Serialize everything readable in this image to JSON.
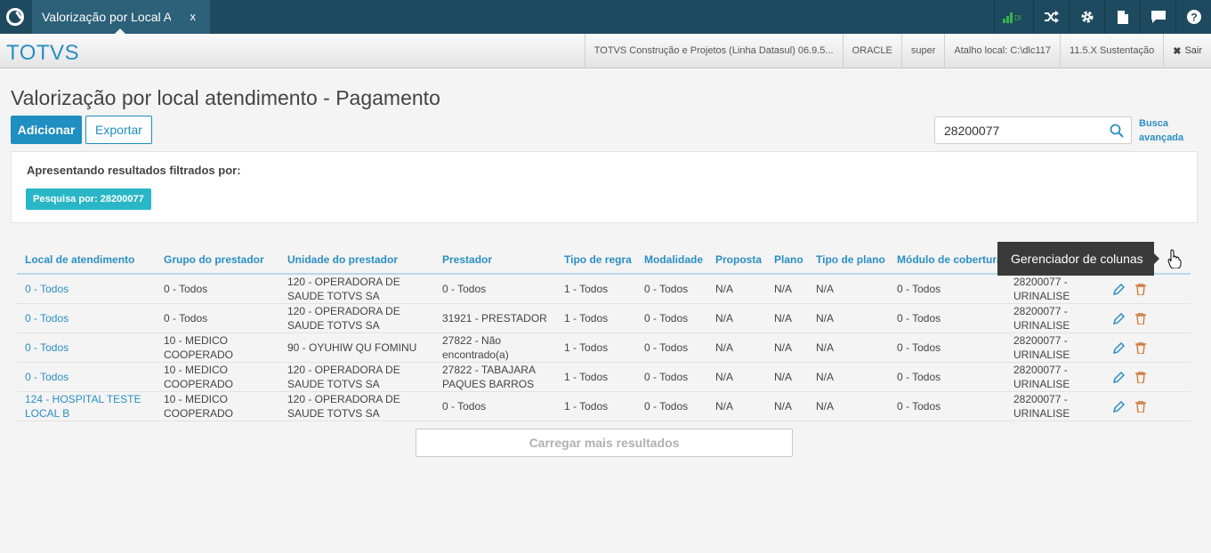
{
  "tab": {
    "title": "Valorização por Local Atendimento",
    "close": "x"
  },
  "topbar": {
    "signal_label": "DI"
  },
  "brand": "TOTVS",
  "info": {
    "product": "TOTVS Construção e Projetos (Linha Datasul) 06.9.5...",
    "db": "ORACLE",
    "user": "super",
    "shortcut": "Atalho local: C:\\dlc117",
    "version": "11.5.X Sustentação",
    "logout": "Sair"
  },
  "page": {
    "title": "Valorização por local atendimento - Pagamento"
  },
  "actions": {
    "add": "Adicionar",
    "export": "Exportar"
  },
  "search": {
    "value": "28200077",
    "advanced": "Busca avançada"
  },
  "filter": {
    "label": "Apresentando resultados filtrados por:",
    "chip": "Pesquisa por: 28200077"
  },
  "table": {
    "headers": [
      "Local de atendimento",
      "Grupo do prestador",
      "Unidade do prestador",
      "Prestador",
      "Tipo de regra",
      "Modalidade",
      "Proposta",
      "Plano",
      "Tipo de plano",
      "Módulo de cobertura",
      ""
    ],
    "rows": [
      [
        "0 - Todos",
        "0 - Todos",
        "120 - OPERADORA DE SAUDE TOTVS SA",
        "0 - Todos",
        "1 - Todos",
        "0 - Todos",
        "N/A",
        "N/A",
        "N/A",
        "0 - Todos",
        "28200077 - URINALISE"
      ],
      [
        "0 - Todos",
        "0 - Todos",
        "120 - OPERADORA DE SAUDE TOTVS SA",
        "31921 - PRESTADOR",
        "1 - Todos",
        "0 - Todos",
        "N/A",
        "N/A",
        "N/A",
        "0 - Todos",
        "28200077 - URINALISE"
      ],
      [
        "0 - Todos",
        "10 - MEDICO COOPERADO",
        "90 - OYUHIW QU FOMINU",
        "27822 - Não encontrado(a)",
        "1 - Todos",
        "0 - Todos",
        "N/A",
        "N/A",
        "N/A",
        "0 - Todos",
        "28200077 - URINALISE"
      ],
      [
        "0 - Todos",
        "10 - MEDICO COOPERADO",
        "120 - OPERADORA DE SAUDE TOTVS SA",
        "27822 - TABAJARA PAQUES BARROS",
        "1 - Todos",
        "0 - Todos",
        "N/A",
        "N/A",
        "N/A",
        "0 - Todos",
        "28200077 - URINALISE"
      ],
      [
        "124 - HOSPITAL TESTE LOCAL B",
        "10 - MEDICO COOPERADO",
        "120 - OPERADORA DE SAUDE TOTVS SA",
        "0 - Todos",
        "1 - Todos",
        "0 - Todos",
        "N/A",
        "N/A",
        "N/A",
        "0 - Todos",
        "28200077 - URINALISE"
      ]
    ]
  },
  "tooltip": "Gerenciador de colunas",
  "load_more": "Carregar mais resultados",
  "colors": {
    "primary": "#1f8ec0",
    "topbar": "#1e4a5f",
    "chip": "#29b6c6"
  }
}
